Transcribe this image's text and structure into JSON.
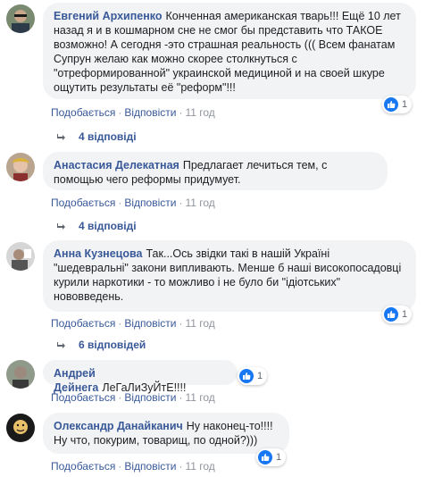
{
  "colors": {
    "link": "#385898",
    "bubble": "#f2f3f5",
    "like": "#1877f2",
    "meta": "#90949c"
  },
  "comments": [
    {
      "author": "Евгений Архипенко",
      "text": "Конченная американская тварь!!! Ещё 10 лет назад я и в кошмарном сне не смог бы представить что ТАКОЕ возможно! А сегодня -это страшная реальность ((( Всем фанатам Супрун желаю как можно скорее столкнуться с \"отреформированной\" украинской медициной и на своей шкуре ощутить результаты её \"реформ\"!!!",
      "likes": "1",
      "like_label": "Подобається",
      "reply_label": "Відповісти",
      "time": "11 год",
      "replies": "4 відповіді"
    },
    {
      "author": "Анастасия Делекатная",
      "text": "Предлагает лечиться тем, с помощью чего реформы придумует.",
      "like_label": "Подобається",
      "reply_label": "Відповісти",
      "time": "11 год",
      "replies": "4 відповіді"
    },
    {
      "author": "Анна Кузнецова",
      "text": "Так...Ось звідки такі в нашій Україні \"шедевральні\" закони випливають. Менше б наші високопосадовці курили наркотики - то можливо і не було би \"ідіотських\" нововведень.",
      "likes": "1",
      "like_label": "Подобається",
      "reply_label": "Відповісти",
      "time": "11 год",
      "replies": "6 відповідей"
    },
    {
      "author": "Андрей Дейнега",
      "text": "ЛеГаЛиЗуЙтЕ!!!!",
      "likes": "1",
      "like_label": "Подобається",
      "reply_label": "Відповісти",
      "time": "11 год"
    },
    {
      "author": "Олександр Данайканич",
      "text": "Ну наконец-то!!!! Ну что, покурим, товарищ, по одной?)))",
      "likes": "1",
      "like_label": "Подобається",
      "reply_label": "Відповісти",
      "time": "11 год"
    }
  ]
}
